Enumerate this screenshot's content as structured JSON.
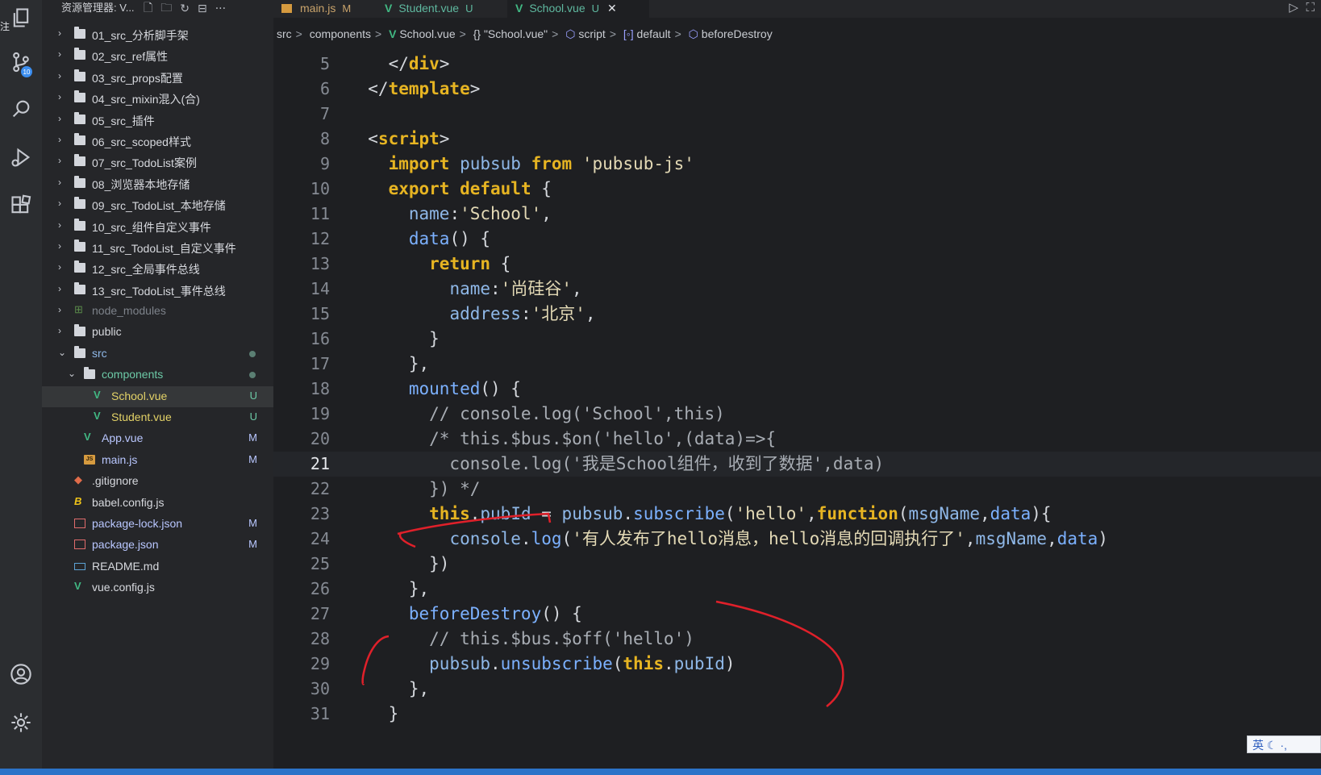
{
  "activity_bar": {
    "mark": "注",
    "icons": [
      "explorer-icon",
      "source-control-icon",
      "search-icon",
      "run-debug-icon",
      "extensions-icon",
      "account-icon",
      "settings-icon"
    ],
    "scm_badge": "10"
  },
  "sidebar": {
    "title": "资源管理器: V...",
    "items": [
      {
        "label": "01_src_分析脚手架",
        "type": "folder",
        "depth": 0,
        "status": ""
      },
      {
        "label": "02_src_ref属性",
        "type": "folder",
        "depth": 0,
        "status": ""
      },
      {
        "label": "03_src_props配置",
        "type": "folder",
        "depth": 0,
        "status": ""
      },
      {
        "label": "04_src_mixin混入(合)",
        "type": "folder",
        "depth": 0,
        "status": ""
      },
      {
        "label": "05_src_插件",
        "type": "folder",
        "depth": 0,
        "status": ""
      },
      {
        "label": "06_src_scoped样式",
        "type": "folder",
        "depth": 0,
        "status": ""
      },
      {
        "label": "07_src_TodoList案例",
        "type": "folder",
        "depth": 0,
        "status": ""
      },
      {
        "label": "08_浏览器本地存储",
        "type": "folder",
        "depth": 0,
        "status": ""
      },
      {
        "label": "09_src_TodoList_本地存储",
        "type": "folder",
        "depth": 0,
        "status": ""
      },
      {
        "label": "10_src_组件自定义事件",
        "type": "folder",
        "depth": 0,
        "status": ""
      },
      {
        "label": "11_src_TodoList_自定义事件",
        "type": "folder",
        "depth": 0,
        "status": ""
      },
      {
        "label": "12_src_全局事件总线",
        "type": "folder",
        "depth": 0,
        "status": ""
      },
      {
        "label": "13_src_TodoList_事件总线",
        "type": "folder",
        "depth": 0,
        "status": ""
      },
      {
        "label": "node_modules",
        "type": "node_modules",
        "depth": 0,
        "status": ""
      },
      {
        "label": "public",
        "type": "folder",
        "depth": 0,
        "status": ""
      },
      {
        "label": "src",
        "type": "folder-open",
        "depth": 0,
        "status": "dot"
      },
      {
        "label": "components",
        "type": "folder-open",
        "depth": 1,
        "status": "dot"
      },
      {
        "label": "School.vue",
        "type": "vue",
        "depth": 2,
        "status": "U"
      },
      {
        "label": "Student.vue",
        "type": "vue",
        "depth": 2,
        "status": "U"
      },
      {
        "label": "App.vue",
        "type": "vue",
        "depth": 1,
        "status": "M"
      },
      {
        "label": "main.js",
        "type": "js",
        "depth": 1,
        "status": "M"
      },
      {
        "label": ".gitignore",
        "type": "git",
        "depth": 0,
        "status": ""
      },
      {
        "label": "babel.config.js",
        "type": "babel",
        "depth": 0,
        "status": ""
      },
      {
        "label": "package-lock.json",
        "type": "json",
        "depth": 0,
        "status": "M"
      },
      {
        "label": "package.json",
        "type": "json",
        "depth": 0,
        "status": "M"
      },
      {
        "label": "README.md",
        "type": "md",
        "depth": 0,
        "status": ""
      },
      {
        "label": "vue.config.js",
        "type": "vue",
        "depth": 0,
        "status": ""
      }
    ]
  },
  "tabs": [
    {
      "label": "main.js",
      "status": "M",
      "kind": "js",
      "active": false
    },
    {
      "label": "Student.vue",
      "status": "U",
      "kind": "vue",
      "active": false
    },
    {
      "label": "School.vue",
      "status": "U",
      "kind": "vue",
      "active": true,
      "close": "✕"
    }
  ],
  "breadcrumb": [
    "src",
    "components",
    "School.vue",
    "{} \"School.vue\"",
    "script",
    "default",
    "beforeDestroy"
  ],
  "editor": {
    "current_line": 21,
    "lines": [
      {
        "n": "5",
        "t": "    </div>"
      },
      {
        "n": "6",
        "t": "  </template>"
      },
      {
        "n": "7",
        "t": ""
      },
      {
        "n": "8",
        "t": "  <script>"
      },
      {
        "n": "9",
        "t": "    import pubsub from 'pubsub-js'"
      },
      {
        "n": "10",
        "t": "    export default {"
      },
      {
        "n": "11",
        "t": "      name:'School',"
      },
      {
        "n": "12",
        "t": "      data() {"
      },
      {
        "n": "13",
        "t": "        return {"
      },
      {
        "n": "14",
        "t": "          name:'尚硅谷',"
      },
      {
        "n": "15",
        "t": "          address:'北京',"
      },
      {
        "n": "16",
        "t": "        }"
      },
      {
        "n": "17",
        "t": "      },"
      },
      {
        "n": "18",
        "t": "      mounted() {"
      },
      {
        "n": "19",
        "t": "        // console.log('School',this)"
      },
      {
        "n": "20",
        "t": "        /* this.$bus.$on('hello',(data)=>{"
      },
      {
        "n": "21",
        "t": "          console.log('我是School组件，收到了数据',data)"
      },
      {
        "n": "22",
        "t": "        }) */"
      },
      {
        "n": "23",
        "t": "        this.pubId = pubsub.subscribe('hello',function(msgName,data){"
      },
      {
        "n": "24",
        "t": "          console.log('有人发布了hello消息，hello消息的回调执行了',msgName,data)"
      },
      {
        "n": "25",
        "t": "        })"
      },
      {
        "n": "26",
        "t": "      },"
      },
      {
        "n": "27",
        "t": "      beforeDestroy() {"
      },
      {
        "n": "28",
        "t": "        // this.$bus.$off('hello')"
      },
      {
        "n": "29",
        "t": "        pubsub.unsubscribe(this.pubId)"
      },
      {
        "n": "30",
        "t": "      },"
      },
      {
        "n": "31",
        "t": "    }"
      }
    ]
  },
  "ime": {
    "label": "英"
  }
}
